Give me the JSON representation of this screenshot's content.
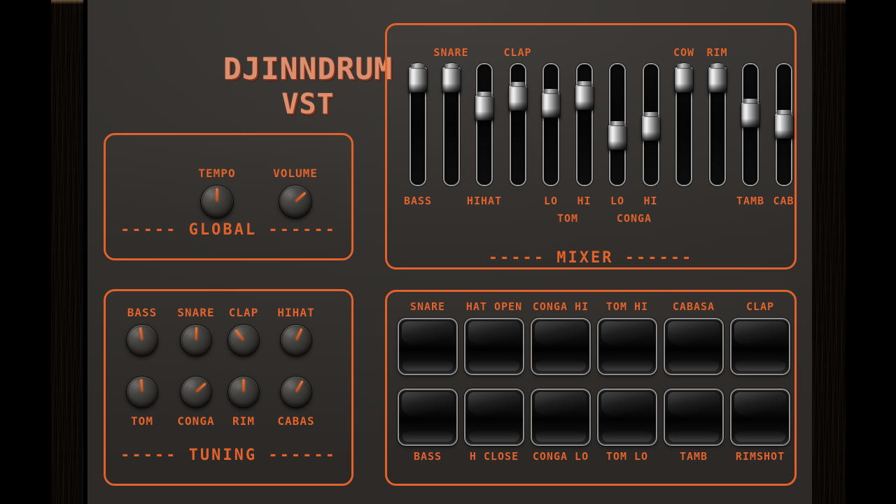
{
  "brand": {
    "line1": "DJINNDRUM",
    "line2": "VST"
  },
  "global": {
    "title": "----- GLOBAL ------",
    "knobs": [
      {
        "label": "TEMPO",
        "angle": 0
      },
      {
        "label": "VOLUME",
        "angle": 48
      }
    ]
  },
  "tuning": {
    "title": "----- TUNING ------",
    "row1": [
      {
        "label": "BASS",
        "angle": -8
      },
      {
        "label": "SNARE",
        "angle": 2
      },
      {
        "label": "CLAP",
        "angle": -38
      },
      {
        "label": "HIHAT",
        "angle": 26
      }
    ],
    "row2": [
      {
        "label": "TOM",
        "angle": -4
      },
      {
        "label": "CONGA",
        "angle": 48
      },
      {
        "label": "RIM",
        "angle": 0
      },
      {
        "label": "CABAS",
        "angle": 30
      }
    ]
  },
  "mixer": {
    "title": "----- MIXER ------",
    "sliders": [
      {
        "label": "BASS",
        "position": "below",
        "value": 100
      },
      {
        "label": "SNARE",
        "position": "above",
        "value": 100
      },
      {
        "label": "HIHAT",
        "position": "below",
        "value": 70
      },
      {
        "label": "CLAP",
        "position": "above",
        "value": 80
      },
      {
        "label": "LO",
        "sublabel": "TOM",
        "position": "below",
        "value": 73
      },
      {
        "label": "HI",
        "position": "below",
        "value": 81
      },
      {
        "label": "LO",
        "sublabel": "CONGA",
        "position": "below",
        "value": 38
      },
      {
        "label": "HI",
        "position": "below",
        "value": 48
      },
      {
        "label": "COW",
        "position": "above",
        "value": 100
      },
      {
        "label": "RIM",
        "position": "above",
        "value": 100
      },
      {
        "label": "TAMB",
        "position": "below",
        "value": 62
      },
      {
        "label": "CAB",
        "position": "below",
        "value": 50
      }
    ]
  },
  "pads": {
    "top_row": [
      {
        "label": "SNARE"
      },
      {
        "label": "HAT OPEN"
      },
      {
        "label": "CONGA HI"
      },
      {
        "label": "TOM HI"
      },
      {
        "label": "CABASA"
      },
      {
        "label": "CLAP"
      }
    ],
    "bottom_row": [
      {
        "label": "BASS"
      },
      {
        "label": "H CLOSE"
      },
      {
        "label": "CONGA LO"
      },
      {
        "label": "TOM LO"
      },
      {
        "label": "TAMB"
      },
      {
        "label": "RIMSHOT"
      }
    ]
  },
  "colors": {
    "accent": "#e2622c",
    "panel": "#35322f",
    "logo": "#dd8e6c",
    "wood": "#8b5329"
  }
}
